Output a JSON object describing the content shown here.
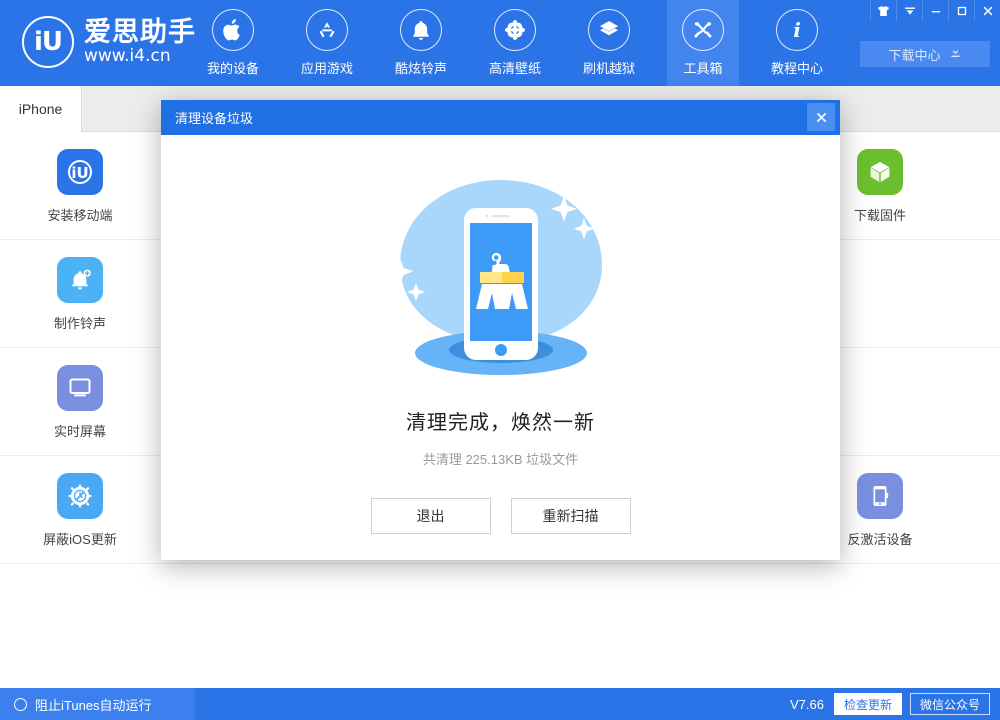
{
  "app": {
    "brand_mark": "iU",
    "brand_name": "爱思助手",
    "brand_url": "www.i4.cn"
  },
  "topnav": {
    "items": [
      {
        "label": "我的设备",
        "icon": "apple-icon",
        "active": false
      },
      {
        "label": "应用游戏",
        "icon": "appstore-icon",
        "active": false
      },
      {
        "label": "酷炫铃声",
        "icon": "bell-icon",
        "active": false
      },
      {
        "label": "高清壁纸",
        "icon": "flower-icon",
        "active": false
      },
      {
        "label": "刷机越狱",
        "icon": "box-icon",
        "active": false
      },
      {
        "label": "工具箱",
        "icon": "tools-icon",
        "active": true
      },
      {
        "label": "教程中心",
        "icon": "info-icon",
        "active": false
      }
    ],
    "download_center": "下载中心",
    "window_controls": [
      {
        "name": "skin-icon"
      },
      {
        "name": "menu-icon"
      },
      {
        "name": "minimize-icon"
      },
      {
        "name": "maximize-icon"
      },
      {
        "name": "close-icon"
      }
    ]
  },
  "tabs": [
    {
      "label": "iPhone",
      "active": true
    }
  ],
  "toolbox": {
    "rows": [
      [
        {
          "label": "安装移动端",
          "icon": "i4-app-icon",
          "color": "#2a74e8"
        },
        {
          "label": "",
          "icon": "",
          "color": ""
        },
        {
          "label": "",
          "icon": "",
          "color": ""
        },
        {
          "label": "",
          "icon": "",
          "color": ""
        },
        {
          "label": "",
          "icon": "",
          "color": ""
        },
        {
          "label": "下载固件",
          "icon": "cube-icon",
          "color": "#6bbf2f"
        }
      ],
      [
        {
          "label": "制作铃声",
          "icon": "bell-plus-icon",
          "color": "#4ab2f5"
        },
        {
          "label": "",
          "icon": "",
          "color": ""
        },
        {
          "label": "",
          "icon": "",
          "color": ""
        },
        {
          "label": "",
          "icon": "",
          "color": ""
        },
        {
          "label": "",
          "icon": "",
          "color": ""
        },
        {
          "label": "",
          "icon": "",
          "color": ""
        }
      ],
      [
        {
          "label": "实时屏幕",
          "icon": "monitor-icon",
          "color": "#7b8fe0"
        },
        {
          "label": "",
          "icon": "",
          "color": ""
        },
        {
          "label": "",
          "icon": "",
          "color": ""
        },
        {
          "label": "",
          "icon": "",
          "color": ""
        },
        {
          "label": "",
          "icon": "",
          "color": ""
        },
        {
          "label": "",
          "icon": "",
          "color": ""
        }
      ],
      [
        {
          "label": "屏蔽iOS更新",
          "icon": "gear-block-icon",
          "color": "#4aa8f5"
        },
        {
          "label": "",
          "icon": "",
          "color": ""
        },
        {
          "label": "",
          "icon": "",
          "color": ""
        },
        {
          "label": "",
          "icon": "",
          "color": ""
        },
        {
          "label": "",
          "icon": "",
          "color": ""
        },
        {
          "label": "反激活设备",
          "icon": "phone-deactivate-icon",
          "color": "#7b8fe0"
        }
      ]
    ]
  },
  "dialog": {
    "title": "清理设备垃圾",
    "close_label": "✕",
    "illustration": "phone-broom-clean-illustration",
    "heading": "清理完成，焕然一新",
    "subtext": "共清理 225.13KB 垃圾文件",
    "buttons": [
      {
        "label": "退出",
        "name": "exit-button"
      },
      {
        "label": "重新扫描",
        "name": "rescan-button"
      }
    ]
  },
  "statusbar": {
    "block_itunes": "阻止iTunes自动运行",
    "version": "V7.66",
    "check_update": "检查更新",
    "wechat": "微信公众号"
  },
  "colors": {
    "brand_blue": "#2a74e8",
    "nav_active": "#4285ef",
    "dialog_header": "#1f6fe5",
    "illustration_blue": "#3d9bf7",
    "illustration_bg": "#a9d6fb",
    "green": "#6bbf2f"
  }
}
